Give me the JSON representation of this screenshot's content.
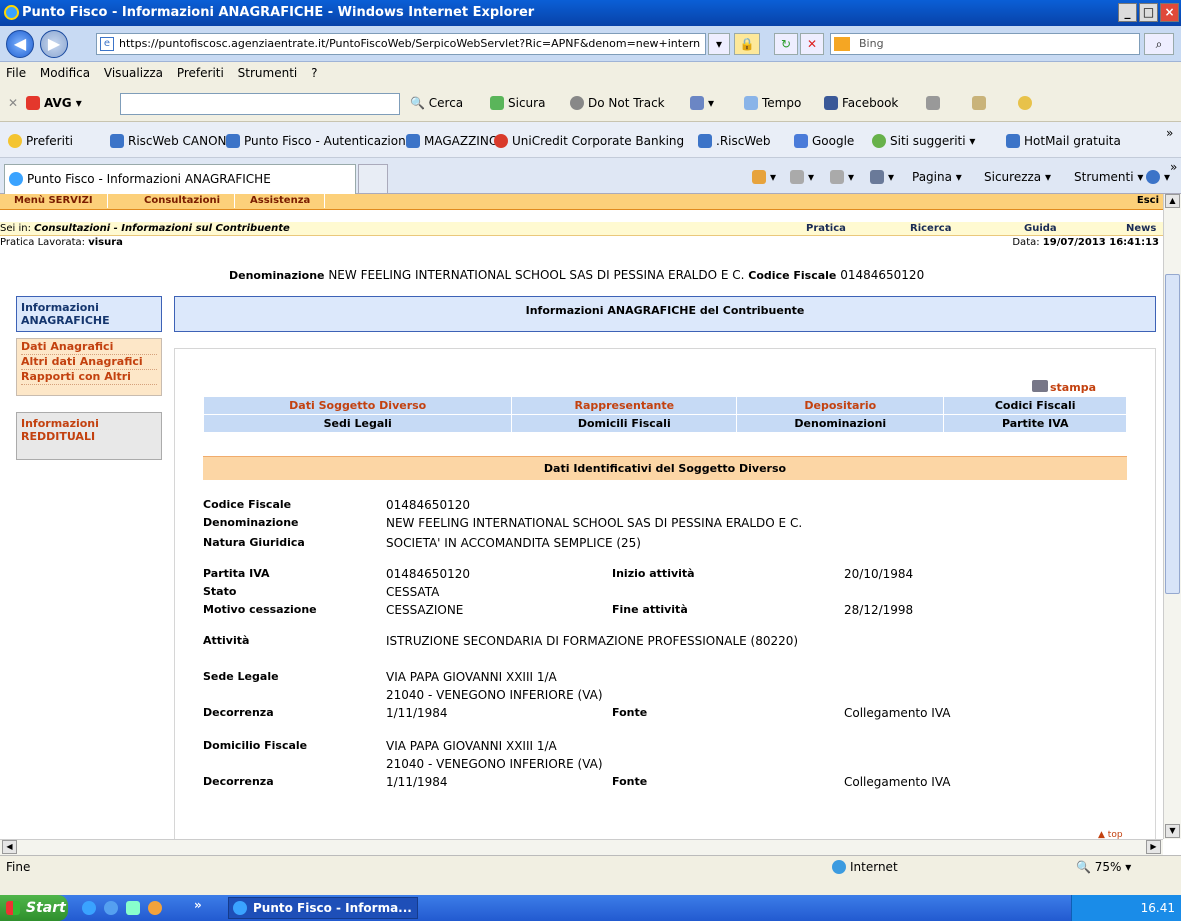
{
  "window": {
    "title": "Punto Fisco - Informazioni ANAGRAFICHE - Windows Internet Explorer",
    "buttons": [
      "_",
      "□",
      "×"
    ]
  },
  "address": {
    "url": "https://puntofiscosc.agenziaentrate.it/PuntoFiscoWeb/SerpicoWebServlet?Ric=APNF&denom=new+intern",
    "search_placeholder": "Bing"
  },
  "menu": [
    "File",
    "Modifica",
    "Visualizza",
    "Preferiti",
    "Strumenti",
    "?"
  ],
  "avg_toolbar": {
    "brand": "AVG",
    "search_label": "Cerca",
    "safe_label": "Sicura",
    "dnt_label": "Do Not Track",
    "weather_label": "Tempo",
    "facebook_label": "Facebook"
  },
  "favorites": {
    "label": "Preferiti",
    "items": [
      "RiscWeb CANONI",
      "Punto Fisco - Autenticazione",
      "MAGAZZINO",
      "UniCredit Corporate Banking",
      ".RiscWeb",
      "Google",
      "Siti suggeriti",
      "HotMail gratuita"
    ]
  },
  "tab": {
    "title": "Punto Fisco - Informazioni ANAGRAFICHE"
  },
  "command_bar": [
    "Pagina",
    "Sicurezza",
    "Strumenti"
  ],
  "app": {
    "top_menu": [
      "Menù SERVIZI",
      "Consultazioni",
      "Assistenza"
    ],
    "exit": "Esci",
    "breadcrumb_prefix": "Sei in:",
    "breadcrumb": "Consultazioni - Informazioni sul Contribuente",
    "links": [
      "Pratica",
      "Ricerca",
      "Guida",
      "News"
    ],
    "pratica_label": "Pratica Lavorata:",
    "pratica_value": "visura",
    "date_label": "Data:",
    "date_value": "19/07/2013 16:41:13",
    "denom_label": "Denominazione",
    "denom_value": "NEW FEELING INTERNATIONAL SCHOOL SAS DI PESSINA ERALDO E C.",
    "cf_label": "Codice Fiscale",
    "cf_value": "01484650120",
    "left_nav": {
      "info_anagrafiche": "Informazioni ANAGRAFICHE",
      "sub": [
        "Dati Anagrafici",
        "Altri dati Anagrafici",
        "Rapporti con Altri"
      ],
      "info_reddituali": "Informazioni REDDITUALI"
    },
    "main_header": "Informazioni ANAGRAFICHE del Contribuente",
    "stampa": "stampa",
    "tabs_row1": [
      "Dati Soggetto Diverso",
      "Rappresentante",
      "Depositario",
      "Codici Fiscali"
    ],
    "tabs_row2": [
      "Sedi Legali",
      "Domicili Fiscali",
      "Denominazioni",
      "Partite IVA"
    ],
    "section_title": "Dati Identificativi del Soggetto Diverso",
    "fields": {
      "codice_fiscale_label": "Codice Fiscale",
      "codice_fiscale": "01484650120",
      "denominazione_label": "Denominazione",
      "denominazione": "NEW FEELING INTERNATIONAL SCHOOL SAS DI PESSINA ERALDO E C.",
      "natura_label": "Natura Giuridica",
      "natura": "SOCIETA' IN ACCOMANDITA SEMPLICE (25)",
      "piva_label": "Partita IVA",
      "piva": "01484650120",
      "inizio_label": "Inizio attività",
      "inizio": "20/10/1984",
      "stato_label": "Stato",
      "stato": "CESSATA",
      "motivo_label": "Motivo cessazione",
      "motivo": "CESSAZIONE",
      "fine_label": "Fine attività",
      "fine": "28/12/1998",
      "attivita_label": "Attività",
      "attivita": "ISTRUZIONE SECONDARIA DI FORMAZIONE PROFESSIONALE (80220)",
      "sede_label": "Sede Legale",
      "sede_line1": "VIA PAPA GIOVANNI XXIII 1/A",
      "sede_line2": "21040 - VENEGONO INFERIORE  (VA)",
      "decorrenza_label": "Decorrenza",
      "decorrenza1": "1/11/1984",
      "fonte_label": "Fonte",
      "fonte1": "Collegamento IVA",
      "domicilio_label": "Domicilio Fiscale",
      "dom_line1": "VIA PAPA GIOVANNI XXIII 1/A",
      "dom_line2": "21040 - VENEGONO INFERIORE  (VA)",
      "decorrenza2": "1/11/1984",
      "fonte2": "Collegamento IVA"
    },
    "top_link": "top"
  },
  "status": {
    "text": "Fine",
    "zone": "Internet",
    "zoom": "75%"
  },
  "taskbar": {
    "start": "Start",
    "item": "Punto Fisco - Informa...",
    "clock": "16.41"
  }
}
